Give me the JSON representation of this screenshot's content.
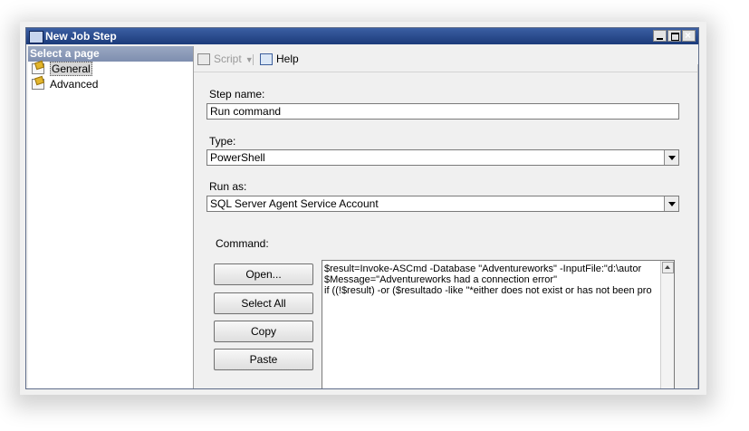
{
  "window": {
    "title": "New Job Step"
  },
  "left_pane": {
    "header": "Select a page",
    "items": [
      {
        "label": "General",
        "selected": true
      },
      {
        "label": "Advanced",
        "selected": false
      }
    ]
  },
  "toolbar": {
    "script_label": "Script",
    "help_label": "Help"
  },
  "form": {
    "step_name_label": "Step name:",
    "step_name_value": "Run command",
    "type_label": "Type:",
    "type_value": "PowerShell",
    "run_as_label": "Run as:",
    "run_as_value": "SQL Server Agent Service Account",
    "command_label": "Command:",
    "command_lines": [
      "$result=Invoke-ASCmd  -Database \"Adventureworks\"  -InputFile:\"d:\\autor",
      "$Message=\"Adventureworks had a connection error\"",
      "if ((!$result) -or ($resultado -like  \"*either does not exist or has not been pro"
    ]
  },
  "buttons": {
    "open": "Open...",
    "select_all": "Select All",
    "copy": "Copy",
    "paste": "Paste"
  },
  "icons": {
    "app": "job-step-icon",
    "script": "script-icon",
    "help": "help-icon",
    "page": "page-icon"
  }
}
